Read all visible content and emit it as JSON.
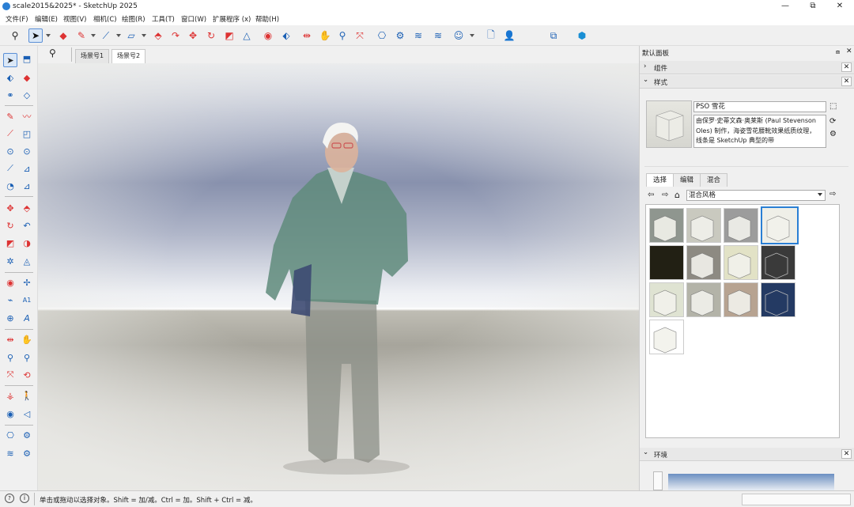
{
  "titlebar": {
    "title": "scale2015&2025* - SketchUp 2025",
    "controls": {
      "minimize": "—",
      "maximize": "⧉",
      "close": "✕"
    }
  },
  "menubar": {
    "items": [
      "文件(F)",
      "编辑(E)",
      "视图(V)",
      "相机(C)",
      "绘图(R)",
      "工具(T)",
      "窗口(W)",
      "扩展程序 (x)",
      "帮助(H)"
    ]
  },
  "scene_tabs": [
    "场景号1",
    "场景号2"
  ],
  "status": {
    "hint": "单击或拖动以选择对象。Shift = 加/减。Ctrl = 加。Shift + Ctrl = 减。"
  },
  "tray": {
    "title": "默认面板",
    "components_label": "组件",
    "styles_label": "样式",
    "style_name": "PSO 雪花",
    "style_description": "由保罗·史蒂文森·奥莱斯 (Paul Stevenson Oles) 制作，海姿雪花腰靴效果纸质纹理，线条是 SketchUp 典型的带",
    "tabs": [
      "选择",
      "编辑",
      "混合"
    ],
    "collection": "混合风格",
    "environment_label": "环境"
  },
  "colors": {
    "accent": "#2a7fd4",
    "selection": "#dbe8f7"
  },
  "icons": {
    "top_toolbar": [
      "zoom-icon",
      "select-icon",
      "eraser-icon",
      "pencil-icon",
      "line-icon",
      "rectangle-icon",
      "pushpull-icon",
      "followme-icon",
      "move-icon",
      "rotate-icon",
      "scale-icon",
      "offset-icon",
      "tape-icon",
      "dimension-icon",
      "protractor-icon",
      "orbit-icon",
      "pan-icon",
      "zoomextents-icon",
      "warehouse-icon",
      "extension-warehouse-icon",
      "layout-icon",
      "profile-icon",
      "new-file-icon",
      "account-icon",
      "extension-manager-icon",
      "cube-icon"
    ],
    "left_toolbar": [
      "select-icon",
      "paint-icon",
      "paint-bucket-icon",
      "eraser-icon",
      "tag-icon",
      "erase-icon",
      "pencil-icon",
      "freehand-icon",
      "line-icon",
      "rectangle-icon",
      "circle-icon",
      "polygon-icon",
      "arc-icon",
      "pie-icon",
      "pushpull-icon",
      "followme-icon",
      "move-icon",
      "pushpull2-icon",
      "rotate-icon",
      "scale-icon",
      "offset-icon",
      "flip-icon",
      "tape-icon",
      "protractor-icon",
      "dimension-icon",
      "text-icon",
      "axes-icon",
      "3dtext-icon",
      "section-icon",
      "section-display-icon",
      "zoom-icon",
      "zoom-window-icon",
      "zoom-extents-icon",
      "previous-icon",
      "position-camera-icon",
      "walk-icon",
      "lookaround-icon",
      "field-of-view-icon",
      "warehouse-icon",
      "share-icon",
      "layers-icon",
      "sandbox-icon"
    ]
  }
}
